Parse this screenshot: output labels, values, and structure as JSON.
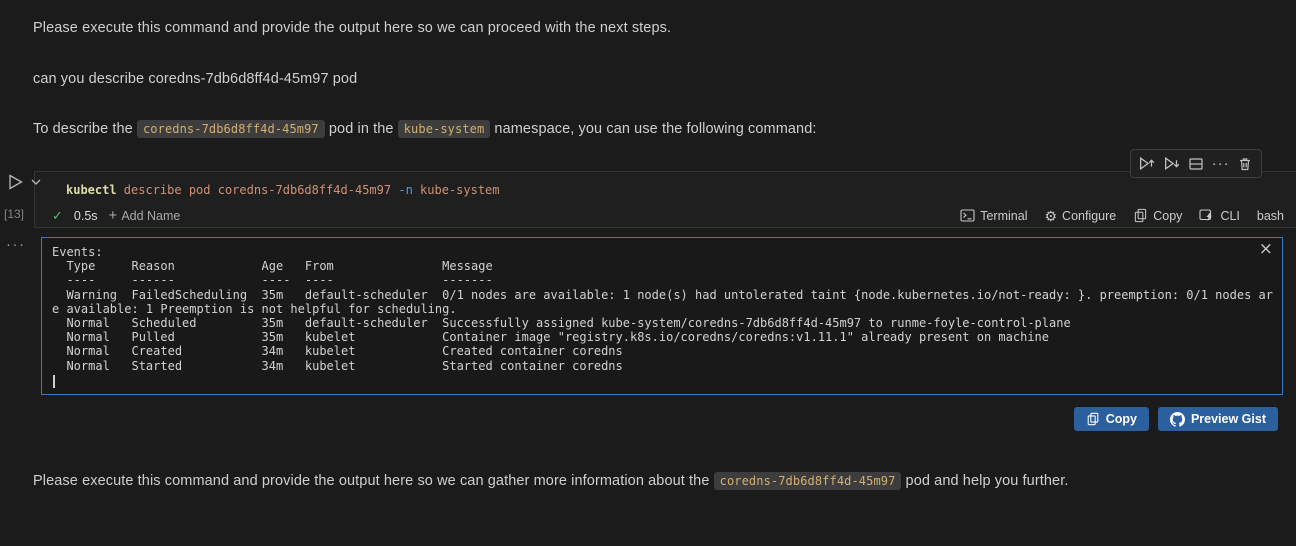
{
  "colors": {
    "page_bg": "#1b1b1b",
    "cell_bg": "#1f1f1f",
    "cell_border": "#343434",
    "output_border": "#3b76c5",
    "output_bg": "#191919",
    "button_bg": "#2b5f9e",
    "inline_code_text": "#d4af6e",
    "inline_code_bg": "#3d3d3d",
    "token_command": "#dcdcaa",
    "token_argument": "#ce9178",
    "token_flag": "#569cd6",
    "success_green": "#5dbb74",
    "body_text": "#cfcfcf"
  },
  "icons": {
    "ellipsis": "···",
    "close": "×",
    "plus": "+",
    "gear": "⚙",
    "check": "✓"
  },
  "messages": {
    "intro": "Please execute this command and provide the output here so we can proceed with the next steps.",
    "user_question": "can you describe coredns-7db6d8ff4d-45m97 pod",
    "describe_prefix": "To describe the ",
    "pod_code": "coredns-7db6d8ff4d-45m97",
    "describe_middle": " pod in the ",
    "namespace_code": "kube-system",
    "describe_suffix": " namespace, you can use the following command:",
    "outro_prefix": "Please execute this command and provide the output here so we can gather more information about the ",
    "outro_code": "coredns-7db6d8ff4d-45m97",
    "outro_suffix": " pod and help you further."
  },
  "cell": {
    "execution_count": "[13]",
    "code": {
      "command": "kubectl ",
      "args": "describe pod coredns-7db6d8ff4d-45m97 ",
      "flag": "-n ",
      "value": "kube-system"
    },
    "status": {
      "duration": "0.5s",
      "add_name": "Add Name",
      "terminal_label": "Terminal",
      "configure_label": "Configure",
      "copy_label": "Copy",
      "cli_label": "CLI",
      "language": "bash"
    }
  },
  "output": {
    "lines": [
      "Events:",
      "  Type     Reason            Age   From               Message",
      "  ----     ------            ----  ----               -------",
      "  Warning  FailedScheduling  35m   default-scheduler  0/1 nodes are available: 1 node(s) had untolerated taint {node.kubernetes.io/not-ready: }. preemption: 0/1 nodes are available: 1 Preemption is not helpful for scheduling.",
      "  Normal   Scheduled         35m   default-scheduler  Successfully assigned kube-system/coredns-7db6d8ff4d-45m97 to runme-foyle-control-plane",
      "  Normal   Pulled            35m   kubelet            Container image \"registry.k8s.io/coredns/coredns:v1.11.1\" already present on machine",
      "  Normal   Created           34m   kubelet            Created container coredns",
      "  Normal   Started           34m   kubelet            Started container coredns"
    ]
  },
  "actions": {
    "copy_label": "Copy",
    "preview_gist_label": "Preview Gist"
  }
}
